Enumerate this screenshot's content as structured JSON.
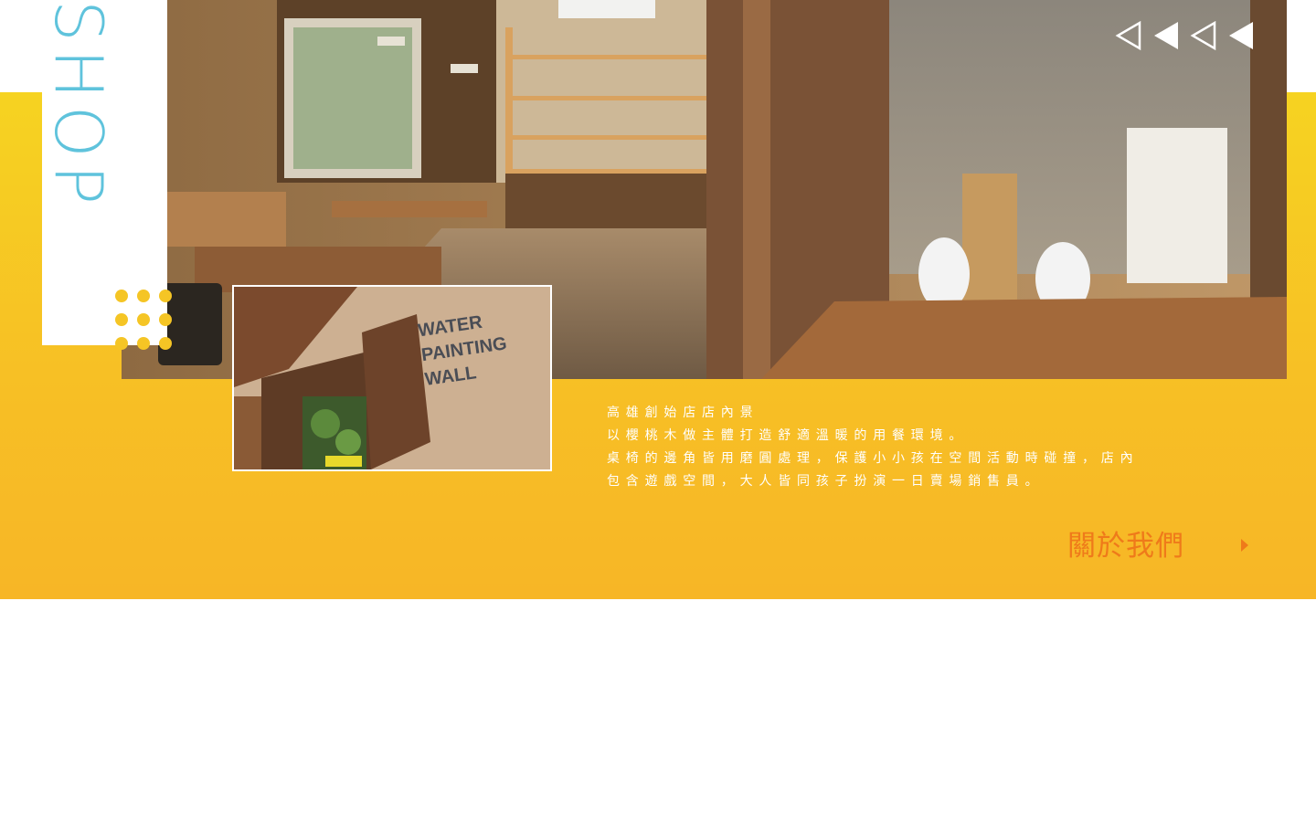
{
  "section": {
    "title": "SHOP",
    "title_color": "#5fc3dc",
    "band_color": "#f7c025",
    "accent_color": "#ef7a1a"
  },
  "hero": {
    "image": "cafe-interior-photo",
    "thumbnail": "water-painting-wall-photo",
    "thumbnail_sign": [
      "WATER",
      "PAINTING",
      "WALL"
    ]
  },
  "carousel": {
    "prev_icon": "triangle-left-outline-icon",
    "icons": [
      "triangle-left-outline-icon",
      "triangle-left-filled-icon",
      "triangle-left-outline-icon",
      "triangle-left-filled-icon"
    ]
  },
  "description": {
    "lines": [
      "高雄創始店店內景",
      "以櫻桃木做主體打造舒適溫暖的用餐環境。",
      "桌椅的邊角皆用磨圓處理，保護小小孩在空間活動時碰撞，店內",
      "包含遊戲空間，大人皆同孩子扮演一日賣場銷售員。"
    ]
  },
  "about_link": {
    "label": "關於我們",
    "icon": "caret-right-icon"
  }
}
